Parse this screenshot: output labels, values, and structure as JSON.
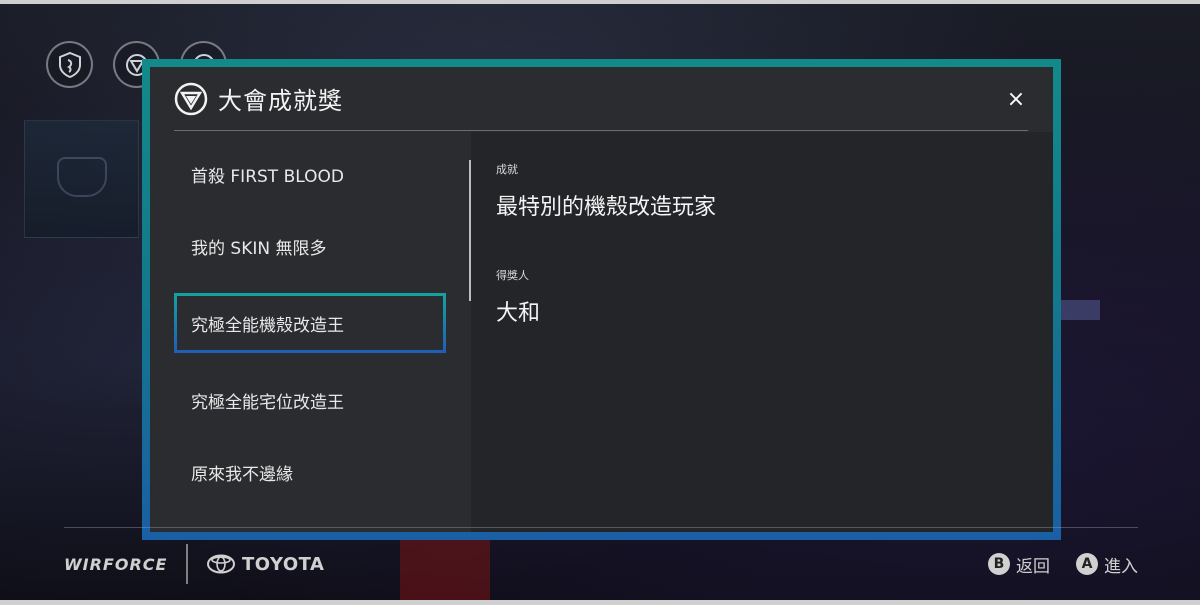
{
  "top_icons": [
    {
      "name": "shield-icon"
    },
    {
      "name": "triangle-badge-icon"
    },
    {
      "name": "triangle-badge-icon"
    }
  ],
  "modal": {
    "title": "大會成就獎",
    "close_label": "×",
    "list": [
      {
        "label": "首殺 FIRST BLOOD",
        "selected": false
      },
      {
        "label": "我的 SKIN 無限多",
        "selected": false
      },
      {
        "label": "究極全能機殼改造王",
        "selected": true
      },
      {
        "label": "究極全能宅位改造王",
        "selected": false
      },
      {
        "label": "原來我不邊緣",
        "selected": false
      }
    ],
    "detail": {
      "achievement_label": "成就",
      "achievement_value": "最特別的機殼改造玩家",
      "winner_label": "得獎人",
      "winner_value": "大和"
    }
  },
  "footer": {
    "brand1": "WIRFORCE",
    "brand2": "TOYOTA",
    "hints": [
      {
        "key": "B",
        "label": "返回"
      },
      {
        "key": "A",
        "label": "進入"
      }
    ]
  },
  "colors": {
    "accent_teal": "#128a8a",
    "accent_blue": "#1a5fa5",
    "modal_bg": "#2b2c2f"
  }
}
